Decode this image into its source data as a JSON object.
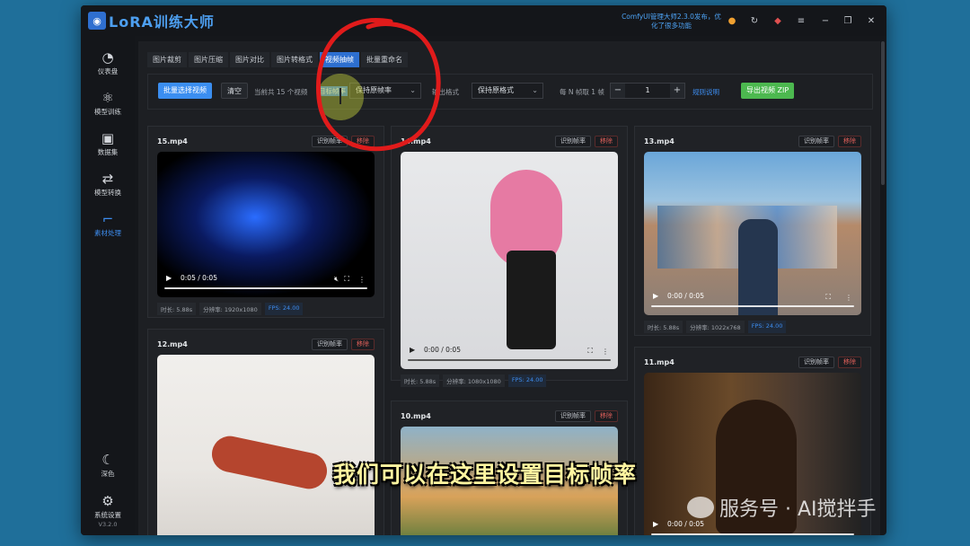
{
  "app": {
    "title": "LoRA训练大师",
    "notice": "ComfyUI管理大师2.3.0发布，优化了很多功能",
    "version": "V3.2.0"
  },
  "sidebar": {
    "items": [
      {
        "label": "仪表盘",
        "icon": "dashboard-icon",
        "glyph": "◔"
      },
      {
        "label": "模型训练",
        "icon": "network-icon",
        "glyph": "⚛"
      },
      {
        "label": "数据集",
        "icon": "images-icon",
        "glyph": "▣"
      },
      {
        "label": "模型转换",
        "icon": "convert-icon",
        "glyph": "⇄"
      },
      {
        "label": "素材处理",
        "icon": "crop-icon",
        "glyph": "⌐"
      }
    ],
    "bottom": [
      {
        "label": "深色",
        "icon": "moon-icon",
        "glyph": "☾"
      },
      {
        "label": "系统设置",
        "icon": "gear-icon",
        "glyph": "⚙"
      }
    ]
  },
  "tabs": [
    "图片裁剪",
    "图片压缩",
    "图片对比",
    "图片转格式",
    "视频抽帧",
    "批量重命名"
  ],
  "active_tab": 4,
  "toolbar": {
    "select_videos": "批量选择视频",
    "clear": "清空",
    "count_text": "当前共 15 个视频",
    "target_fps_label": "目标帧率",
    "target_fps_value": "保持原帧率",
    "output_format_label": "输出格式",
    "output_format_value": "保持原格式",
    "every_n_label": "每 N 帧取 1 帧",
    "step_minus": "−",
    "step_value": "1",
    "step_plus": "+",
    "rules_link": "规则说明",
    "export_button": "导出视频 ZIP"
  },
  "cards": [
    {
      "name": "15.mp4",
      "detect": "识别帧率",
      "remove": "移除",
      "time": "0:05 / 0:05",
      "duration": "时长: 5.88s",
      "resolution": "分辨率: 1920x1080",
      "fps": "FPS: 24.00"
    },
    {
      "name": "14.mp4",
      "detect": "识别帧率",
      "remove": "移除",
      "time": "0:00 / 0:05",
      "duration": "时长: 5.88s",
      "resolution": "分辨率: 1080x1080",
      "fps": "FPS: 24.00"
    },
    {
      "name": "13.mp4",
      "detect": "识别帧率",
      "remove": "移除",
      "time": "0:00 / 0:05",
      "duration": "时长: 5.88s",
      "resolution": "分辨率: 1022x768",
      "fps": "FPS: 24.00"
    },
    {
      "name": "12.mp4",
      "detect": "识别帧率",
      "remove": "移除"
    },
    {
      "name": "10.mp4",
      "detect": "识别帧率",
      "remove": "移除"
    },
    {
      "name": "11.mp4",
      "detect": "识别帧率",
      "remove": "移除",
      "time": "0:00 / 0:05"
    }
  ],
  "overlay": {
    "subtitle": "我们可以在这里设置目标帧率",
    "watermark": "服务号 · AI搅拌手"
  }
}
